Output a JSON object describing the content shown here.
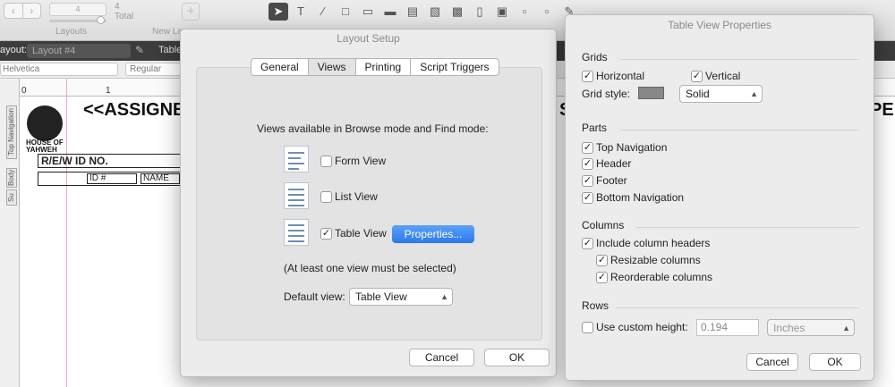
{
  "toolbar": {
    "record_count": "4",
    "total_label": "Total",
    "layouts_label": "Layouts",
    "new_layout_label": "New La"
  },
  "layoutbar": {
    "layout_label": "ayout:",
    "layout_value": "Layout #4",
    "table_label": "Table"
  },
  "formatbar": {
    "font": "Helvetica",
    "style": "Regular"
  },
  "ruler": {
    "zero": "0",
    "one": "1",
    "right": "0"
  },
  "canvas": {
    "title": "<<ASSIGNE",
    "title_right": "PE",
    "title_mid": "S",
    "logo_lines": [
      "HOUSE OF",
      "YAHWEH"
    ],
    "header_cell": "R/E/W    ID NO.",
    "id_cell": "ID #",
    "name_cell": "NAME",
    "parts": [
      "Top Navigation",
      "Body",
      "Su"
    ]
  },
  "layout_setup": {
    "title": "Layout Setup",
    "tabs": [
      "General",
      "Views",
      "Printing",
      "Script Triggers"
    ],
    "selected_tab": "Views",
    "heading": "Views available in Browse mode and Find mode:",
    "form_view": {
      "label": "Form View",
      "checked": false
    },
    "list_view": {
      "label": "List View",
      "checked": false
    },
    "table_view": {
      "label": "Table View",
      "checked": true
    },
    "properties_button": "Properties...",
    "note": "(At least one view must be selected)",
    "default_view_label": "Default view:",
    "default_view_value": "Table View",
    "cancel": "Cancel",
    "ok": "OK"
  },
  "table_view_properties": {
    "title": "Table View Properties",
    "grids": {
      "heading": "Grids",
      "horizontal": {
        "label": "Horizontal",
        "checked": true
      },
      "vertical": {
        "label": "Vertical",
        "checked": true
      },
      "grid_style_label": "Grid style:",
      "grid_color": "#888888",
      "grid_style_value": "Solid"
    },
    "parts": {
      "heading": "Parts",
      "items": [
        {
          "label": "Top Navigation",
          "checked": true
        },
        {
          "label": "Header",
          "checked": true
        },
        {
          "label": "Footer",
          "checked": true
        },
        {
          "label": "Bottom Navigation",
          "checked": true
        }
      ]
    },
    "columns": {
      "heading": "Columns",
      "include_headers": {
        "label": "Include column headers",
        "checked": true
      },
      "resizable": {
        "label": "Resizable columns",
        "checked": true
      },
      "reorderable": {
        "label": "Reorderable columns",
        "checked": true
      }
    },
    "rows": {
      "heading": "Rows",
      "custom_height": {
        "label": "Use custom height:",
        "checked": false
      },
      "height_value": "0.194",
      "unit_value": "Inches"
    },
    "cancel": "Cancel",
    "ok": "OK"
  },
  "colors": {
    "accent": "#2b79ef",
    "pink_guide": "#f2a6c8"
  }
}
